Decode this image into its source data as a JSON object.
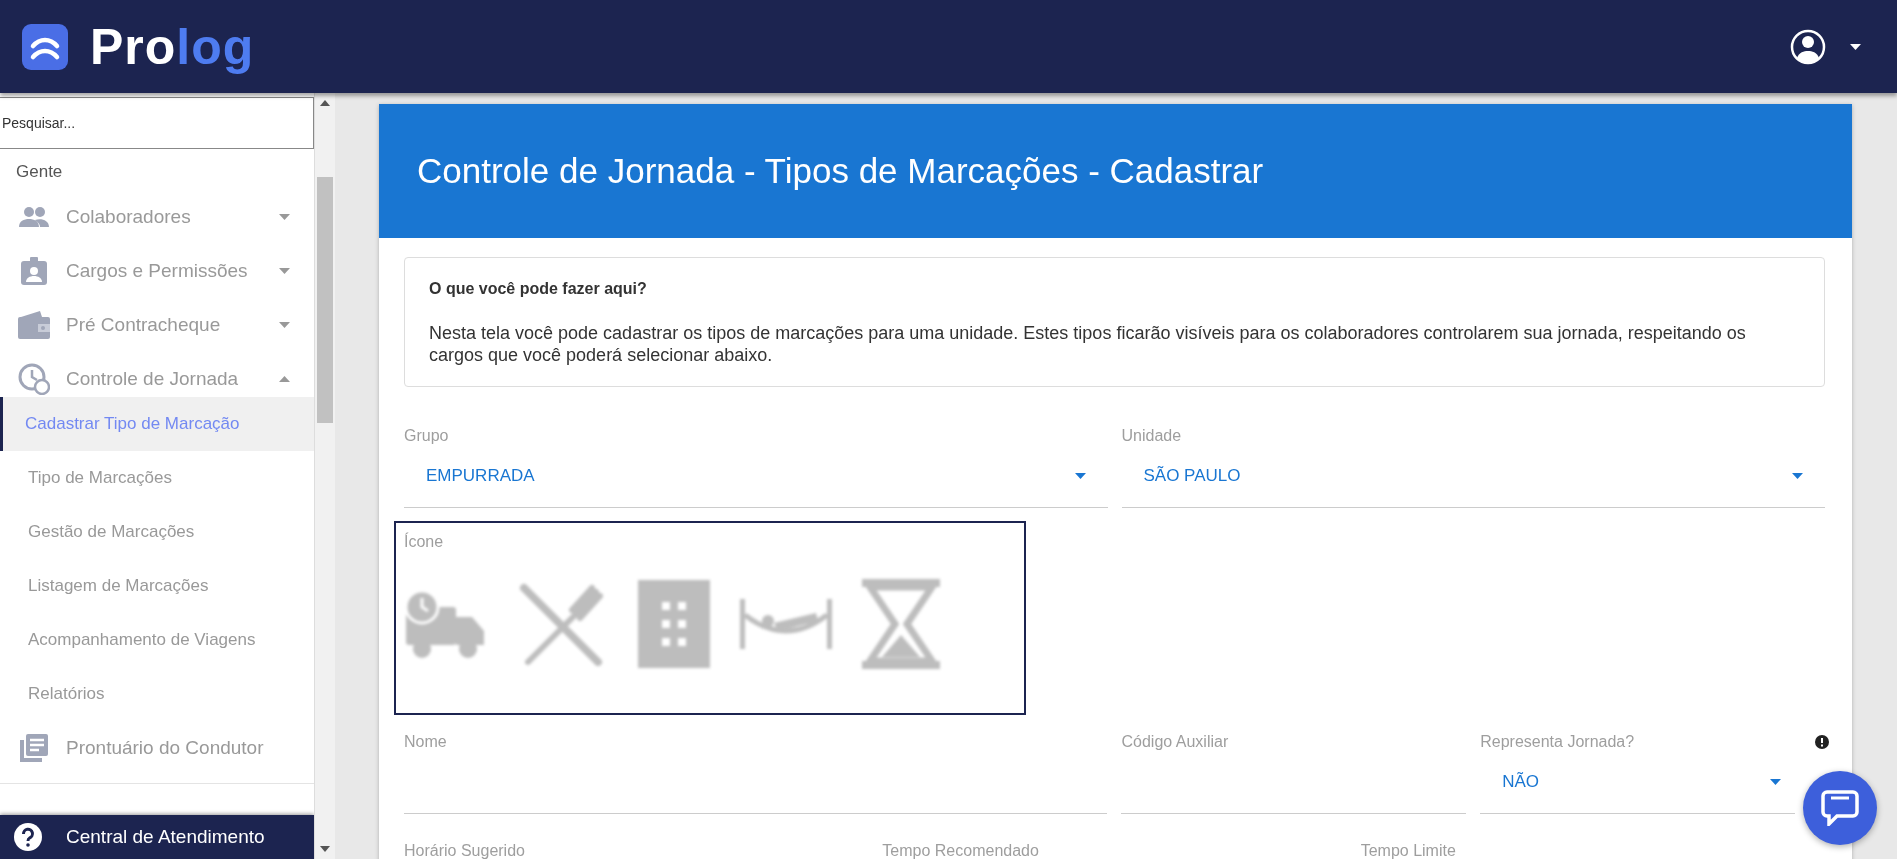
{
  "header": {
    "logo": {
      "text_start": "Pro",
      "text_end": "log"
    }
  },
  "sidebar": {
    "search": {
      "placeholder": "Pesquisar..."
    },
    "section": "Gente",
    "items": [
      {
        "label": "Colaboradores",
        "expanded": false,
        "kind": "people"
      },
      {
        "label": "Cargos e Permissões",
        "expanded": false,
        "kind": "badge"
      },
      {
        "label": "Pré Contracheque",
        "expanded": false,
        "kind": "wallet"
      },
      {
        "label": "Controle de Jornada",
        "expanded": true,
        "kind": "clock",
        "children": [
          {
            "label": "Cadastrar Tipo de Marcação",
            "selected": true
          },
          {
            "label": "Tipo de Marcações",
            "selected": false
          },
          {
            "label": "Gestão de Marcações",
            "selected": false
          },
          {
            "label": "Listagem de Marcações",
            "selected": false
          },
          {
            "label": "Acompanhamento de Viagens",
            "selected": false
          },
          {
            "label": "Relatórios",
            "selected": false
          }
        ]
      },
      {
        "label": "Prontuário do Condutor",
        "kind": "document"
      }
    ],
    "footer": "Central de Atendimento"
  },
  "page_title": "Controle de Jornada - Tipos de Marcações - Cadastrar",
  "help": {
    "title": "O que você pode fazer aqui?",
    "text": "Nesta tela você pode cadastrar os tipos de marcações para uma unidade. Estes tipos ficarão visíveis para os colaboradores controlarem sua jornada, respeitando os cargos que você poderá selecionar abaixo."
  },
  "form": {
    "rows": [
      [
        {
          "kind": "select",
          "label": "Grupo",
          "value": "EMPURRADA"
        },
        {
          "kind": "select",
          "label": "Unidade",
          "value": "SÃO PAULO"
        }
      ],
      [
        {
          "kind": "icons",
          "label": "Ícone",
          "focused": true
        }
      ],
      [
        {
          "kind": "text",
          "label": "Nome"
        },
        {
          "kind": "text",
          "label": "Código Auxiliar"
        },
        {
          "kind": "select",
          "label": "Representa Jornada?",
          "value": "NÃO",
          "info": true
        }
      ],
      [
        {
          "kind": "text",
          "label": "Horário Sugerido"
        },
        {
          "kind": "text",
          "label": "Tempo Recomendado"
        },
        {
          "kind": "text",
          "label": "Tempo Limite"
        }
      ]
    ]
  }
}
